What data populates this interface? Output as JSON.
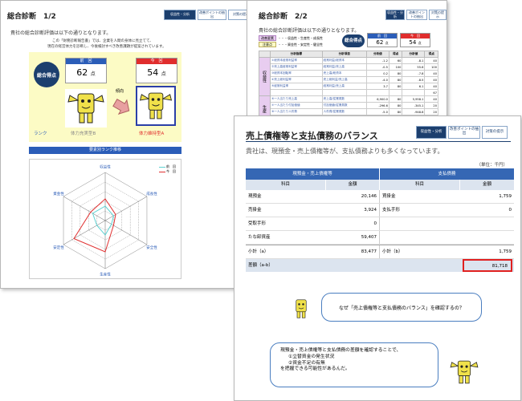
{
  "page1": {
    "title": "総合診断　1/2",
    "subtitle": "貴社の総合診断評価は以下の通りとなります。",
    "nav": [
      "収益性・分析",
      "改善ポイントの抽出",
      "対策の提示"
    ],
    "intro_line1": "この「財務診断報告書」では、企業を人間の身体に見立てて、",
    "intro_line2": "現在の経営体力を診断し、今後検討すべき改善課題が提案されています。",
    "score_label": "総合得点",
    "prev_label": "前　回",
    "curr_label": "今　回",
    "prev_score": "62",
    "curr_score": "54",
    "unit": "点",
    "trend_label": "傾向",
    "rank_label": "ランク",
    "prev_rank": "体力充実型B",
    "curr_rank": "体力維持型A",
    "rank_section": "要素別ランク推移",
    "radar_axes": [
      "収益性",
      "成長性",
      "安全性",
      "生産性",
      "安定性",
      "資金性"
    ],
    "legend": [
      "前　回",
      "今　回"
    ],
    "radar_prev": [
      0.3,
      0.2,
      0.15,
      0.3,
      0.2,
      0.3
    ],
    "radar_curr": [
      0.45,
      0.25,
      0.2,
      0.65,
      0.75,
      0.35
    ]
  },
  "page2": {
    "title": "総合診断　2/2",
    "subtitle": "貴社の総合診断評価は以下の通りとなります。",
    "nav": [
      "収益性・分析",
      "改善ポイントの抽出",
      "対策の提示"
    ],
    "legend_tag1": "改善要素",
    "legend_tag2": "注意点",
    "legend_lines": [
      "・・・収益性・生産性・成長性",
      "・・・資金性・安定性・健全性"
    ],
    "score_label": "総合得点",
    "prev_label": "前　回",
    "curr_label": "今　回",
    "prev_score": "62",
    "curr_score": "54",
    "unit": "点",
    "table_headers": [
      "分析指標",
      "分析項目",
      "分析値",
      "得点",
      "分析値",
      "得点"
    ],
    "groups": [
      "収益性",
      "生産"
    ],
    "rows": [
      [
        "①総資本経常利益率",
        "経常利益/総資本",
        "-1.2",
        "60",
        "-8.1",
        "40"
      ],
      [
        "②売上高経常利益率",
        "経常利益/売上高",
        "-0.5",
        "100",
        "55.6",
        "100"
      ],
      [
        "③総資本回転率",
        "売上高/総資本",
        "0.2",
        "80",
        "-7.8",
        "40"
      ],
      [
        "④売上総利益率",
        "売上総利益/売上高",
        "-4.0",
        "80",
        "-8.5",
        "40"
      ],
      [
        "⑤経常利益率",
        "経常利益/売上高",
        "3.7",
        "80",
        "6.1",
        "40"
      ],
      [
        "",
        "",
        "",
        "",
        "",
        "67"
      ],
      [
        "⑥一人当たり売上高",
        "売上高/従業員数",
        "6,900.0",
        "80",
        "5,958.1",
        "40"
      ],
      [
        "⑦一人当たり付加価値",
        "付加価値/従業員数",
        "-296.6",
        "80",
        "-345.1",
        "20"
      ],
      [
        "⑧一人当たり人件費",
        "人件費/従業員数",
        "-5.0",
        "80",
        "-948.8",
        "20"
      ],
      [
        "⑨労働分配率",
        "人件費/付加価値",
        "-6.0",
        "60",
        "-5.5",
        "40"
      ]
    ]
  },
  "page3": {
    "title": "売上債権等と支払債務のバランス",
    "nav": [
      "収益性・分析",
      "改善ポイントの抽出",
      "対策の提示"
    ],
    "subtitle": "貴社は、現預金・売上債権等が、支払債務よりも多くなっています。",
    "unit_note": "（単位：千円）",
    "left_header": "現預金・売上債権等",
    "right_header": "支払債務",
    "col_item": "科目",
    "col_amount": "金額",
    "left_rows": [
      {
        "label": "現預金",
        "value": "20,146"
      },
      {
        "label": "売掛金",
        "value": "3,924"
      },
      {
        "label": "受取手形",
        "value": "0"
      },
      {
        "label": "たな卸資産",
        "value": "59,407"
      },
      {
        "label": "小計（a）",
        "value": "83,477"
      }
    ],
    "right_rows": [
      {
        "label": "買掛金",
        "value": "1,759"
      },
      {
        "label": "支払手形",
        "value": "0"
      },
      {
        "label": "",
        "value": ""
      },
      {
        "label": "",
        "value": ""
      },
      {
        "label": "小計（b）",
        "value": "1,759"
      }
    ],
    "diff_label": "差額（a-b）",
    "diff_value": "81,718",
    "bubble1": "なぜ「売上債権等と支払債務のバランス」を確認するの？",
    "bubble2_lines": [
      "現預金・売上債権等と支払債務の差額を確認することで、",
      "①立替資金の発生状況",
      "②資金不足の有無",
      "を把握できる可能性があるんだ。"
    ]
  },
  "colors": {
    "navy": "#1c3f6e",
    "header_blue": "#3567b4",
    "yellow": "#fcfbc5",
    "score_prev": "#2b5db8",
    "score_curr": "#e02d2d",
    "mascot": "#f0e14a",
    "highlight": "#e02020"
  }
}
